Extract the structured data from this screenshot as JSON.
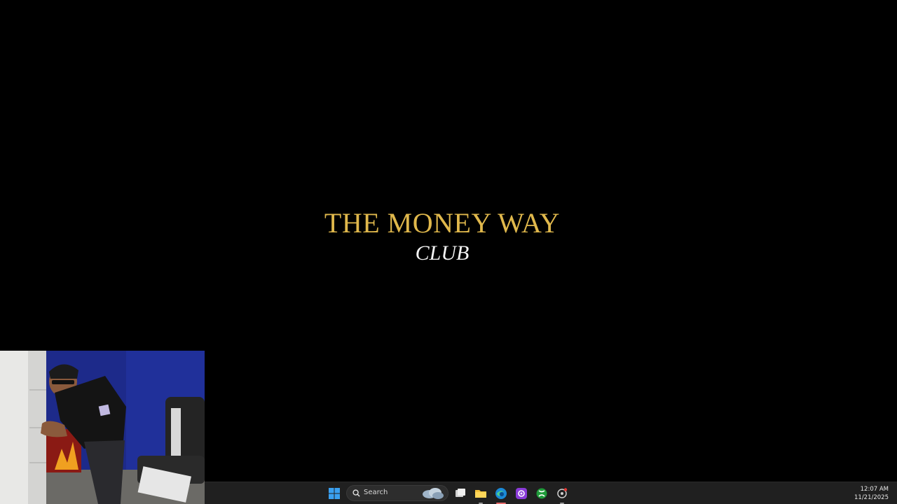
{
  "slide": {
    "title": "THE MONEY WAY",
    "subtitle": "CLUB"
  },
  "webcam": {
    "icon": "webcam-feed"
  },
  "taskbar": {
    "search_placeholder": "Search",
    "icons": [
      "windows-start-icon",
      "search-icon",
      "weather-widget-icon",
      "task-view-icon",
      "file-explorer-icon",
      "edge-browser-icon",
      "photo-app-icon",
      "xbox-icon",
      "settings-icon"
    ],
    "clock": {
      "time": "12:07 AM",
      "date": "11/21/2025"
    }
  },
  "colors": {
    "title_gold": "#e0b84c",
    "subtitle_white": "#f4f4f4",
    "taskbar_bg": "#202020",
    "background": "#000000"
  }
}
